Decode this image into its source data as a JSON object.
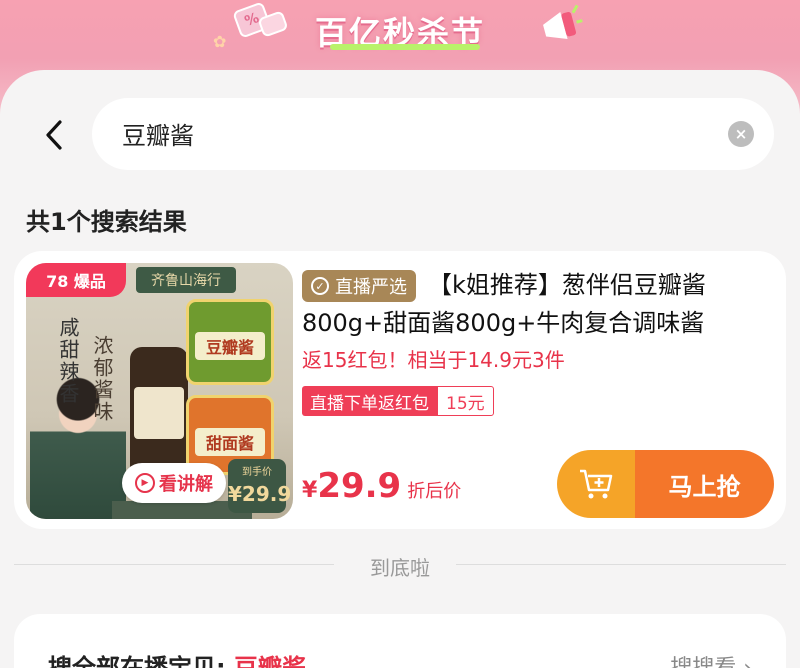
{
  "banner": {
    "title": "百亿秒杀节"
  },
  "search": {
    "query": "豆瓣酱",
    "clear_icon": "×"
  },
  "results": {
    "count_text": "共1个搜索结果"
  },
  "product": {
    "thumb_tag": "78 爆品",
    "thumb_sign": "齐鲁山海行",
    "thumb_slogan_1": "咸甜辣香",
    "thumb_slogan_2": "浓郁酱味",
    "thumb_jar1": "豆瓣酱",
    "thumb_jar2": "甜面酱",
    "thumb_badge_small": "到手价",
    "thumb_badge_price": "29.9",
    "watch_label": "看讲解",
    "live_badge": "直播严选",
    "title": "【k姐推荐】葱伴侣豆瓣酱800g+甜面酱800g+牛肉复合调味酱",
    "promo": "返15红包！相当于14.9元3件",
    "tag_left": "直播下单返红包",
    "tag_right": "15元",
    "price_symbol": "¥",
    "price": "29.9",
    "price_label": "折后价",
    "buy_label": "马上抢"
  },
  "footer": {
    "end_text": "到底啦"
  },
  "bottom": {
    "title_prefix": "搜全部在播宝贝: ",
    "title_keyword": "豆瓣酱",
    "more": "搜搜看 ›"
  },
  "colors": {
    "accent": "#e8334a",
    "banner": "#f2a0b3",
    "button": "#f4762a",
    "live_badge": "#a88757"
  }
}
